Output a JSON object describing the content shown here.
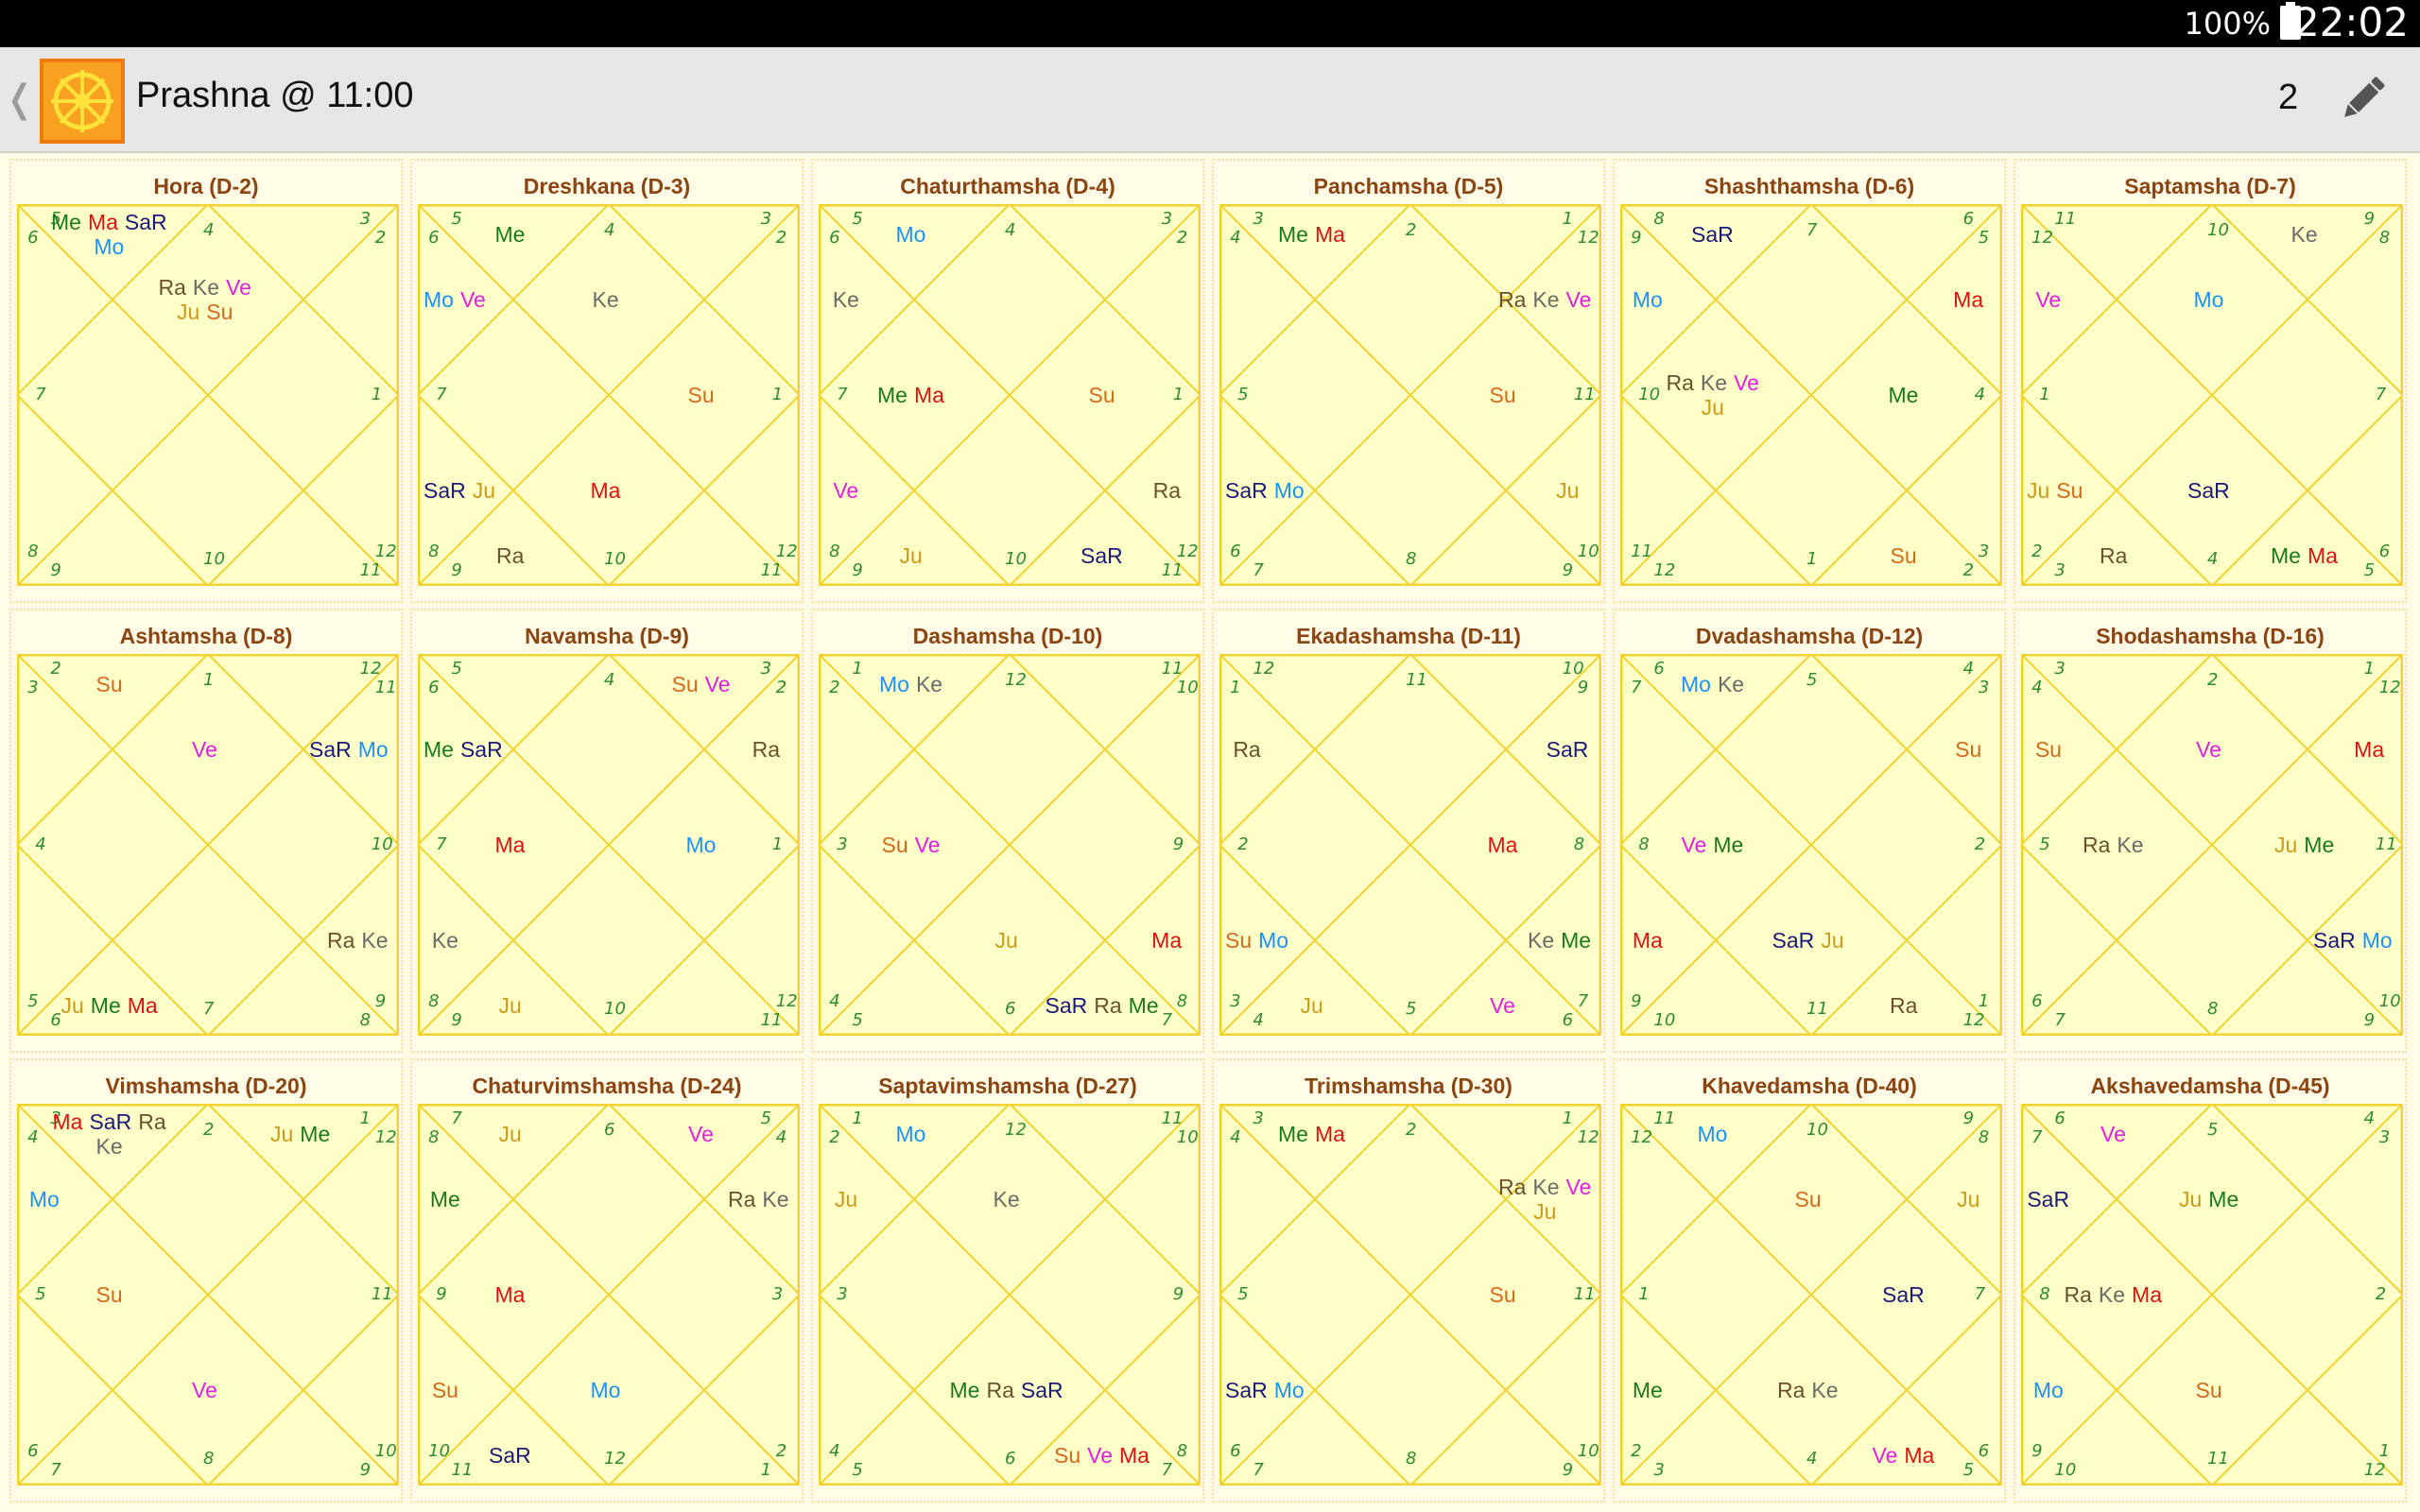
{
  "status_bar": {
    "battery": "100%",
    "time": "22:02"
  },
  "app_bar": {
    "title": "Prashna @ 11:00",
    "count": "2",
    "back_icon": "chevron-left-icon",
    "edit_icon": "pencil-icon",
    "logo_icon": "wheel-logo-icon"
  },
  "colors": {
    "background": "#fffbe6",
    "chart_fill": "#ffffc8",
    "chart_line": "#f0d232",
    "title": "#8b4513",
    "house_number": "#2e8b2e",
    "planets": {
      "Su": "#d2691e",
      "Mo": "#1e90ff",
      "Ma": "#dd1111",
      "Me": "#1a7a1a",
      "Ju": "#cc9a1a",
      "Ve": "#e020e0",
      "SaR": "#1a1a7a",
      "Ra": "#6b5030",
      "Ke": "#6a6a6a"
    }
  },
  "charts": [
    {
      "title": "Hora (D-2)",
      "numbers": [
        "5",
        "3",
        "4",
        "6",
        "2",
        "7",
        "1",
        "8",
        "10",
        "12",
        "9",
        "11"
      ],
      "houses": [
        [
          "Ra",
          "Ke",
          "Ve",
          "Ju",
          "Su"
        ],
        [
          "Me",
          "Ma",
          "SaR",
          "Mo"
        ],
        [],
        [],
        [],
        [],
        [],
        [],
        [],
        [],
        [],
        []
      ]
    },
    {
      "title": "Dreshkana (D-3)",
      "numbers": [
        "5",
        "3",
        "4",
        "6",
        "2",
        "7",
        "1",
        "8",
        "10",
        "12",
        "9",
        "11"
      ],
      "houses": [
        [
          "Ke"
        ],
        [
          "Me"
        ],
        [
          "Mo",
          "Ve"
        ],
        [],
        [
          "SaR",
          "Ju"
        ],
        [
          "Ra"
        ],
        [
          "Ma"
        ],
        [],
        [],
        [
          "Su"
        ],
        [],
        []
      ]
    },
    {
      "title": "Chaturthamsha (D-4)",
      "numbers": [
        "5",
        "3",
        "4",
        "6",
        "2",
        "7",
        "1",
        "8",
        "10",
        "12",
        "9",
        "11"
      ],
      "houses": [
        [],
        [
          "Mo"
        ],
        [
          "Ke"
        ],
        [
          "Me",
          "Ma"
        ],
        [
          "Ve"
        ],
        [
          "Ju"
        ],
        [],
        [
          "SaR"
        ],
        [
          "Ra"
        ],
        [
          "Su"
        ],
        [],
        []
      ]
    },
    {
      "title": "Panchamsha (D-5)",
      "numbers": [
        "3",
        "1",
        "2",
        "4",
        "12",
        "5",
        "11",
        "6",
        "8",
        "10",
        "7",
        "9"
      ],
      "houses": [
        [],
        [
          "Me",
          "Ma"
        ],
        [],
        [],
        [
          "SaR",
          "Mo"
        ],
        [],
        [],
        [],
        [
          "Ju"
        ],
        [
          "Su"
        ],
        [
          "Ra",
          "Ke",
          "Ve"
        ],
        []
      ]
    },
    {
      "title": "Shashthamsha (D-6)",
      "numbers": [
        "8",
        "6",
        "7",
        "9",
        "5",
        "10",
        "4",
        "11",
        "1",
        "3",
        "12",
        "2"
      ],
      "houses": [
        [],
        [
          "SaR"
        ],
        [
          "Mo"
        ],
        [
          "Ra",
          "Ke",
          "Ve",
          "Ju"
        ],
        [],
        [],
        [],
        [
          "Su"
        ],
        [],
        [
          "Me"
        ],
        [
          "Ma"
        ],
        []
      ]
    },
    {
      "title": "Saptamsha (D-7)",
      "numbers": [
        "11",
        "9",
        "10",
        "12",
        "8",
        "1",
        "7",
        "2",
        "4",
        "6",
        "3",
        "5"
      ],
      "houses": [
        [
          "Mo"
        ],
        [],
        [
          "Ve"
        ],
        [],
        [
          "Ju",
          "Su"
        ],
        [
          "Ra"
        ],
        [
          "SaR"
        ],
        [
          "Me",
          "Ma"
        ],
        [],
        [],
        [],
        [
          "Ke"
        ]
      ]
    },
    {
      "title": "Ashtamsha (D-8)",
      "numbers": [
        "2",
        "12",
        "1",
        "3",
        "11",
        "4",
        "10",
        "5",
        "7",
        "9",
        "6",
        "8"
      ],
      "houses": [
        [
          "Ve"
        ],
        [
          "Su"
        ],
        [],
        [],
        [],
        [
          "Ju",
          "Me",
          "Ma"
        ],
        [],
        [],
        [
          "Ra",
          "Ke"
        ],
        [],
        [
          "SaR",
          "Mo"
        ],
        []
      ]
    },
    {
      "title": "Navamsha (D-9)",
      "numbers": [
        "5",
        "3",
        "4",
        "6",
        "2",
        "7",
        "1",
        "8",
        "10",
        "12",
        "9",
        "11"
      ],
      "houses": [
        [],
        [],
        [
          "Me",
          "SaR"
        ],
        [
          "Ma"
        ],
        [
          "Ke"
        ],
        [
          "Ju"
        ],
        [],
        [],
        [],
        [
          "Mo"
        ],
        [
          "Ra"
        ],
        [
          "Su",
          "Ve"
        ]
      ]
    },
    {
      "title": "Dashamsha (D-10)",
      "numbers": [
        "1",
        "11",
        "12",
        "2",
        "10",
        "3",
        "9",
        "4",
        "6",
        "8",
        "5",
        "7"
      ],
      "houses": [
        [],
        [
          "Mo",
          "Ke"
        ],
        [],
        [
          "Su",
          "Ve"
        ],
        [],
        [],
        [
          "Ju"
        ],
        [
          "SaR",
          "Ra",
          "Me"
        ],
        [
          "Ma"
        ],
        [],
        [],
        []
      ]
    },
    {
      "title": "Ekadashamsha (D-11)",
      "numbers": [
        "12",
        "10",
        "11",
        "1",
        "9",
        "2",
        "8",
        "3",
        "5",
        "7",
        "4",
        "6"
      ],
      "houses": [
        [],
        [],
        [
          "Ra"
        ],
        [],
        [
          "Su",
          "Mo"
        ],
        [
          "Ju"
        ],
        [],
        [
          "Ve"
        ],
        [
          "Ke",
          "Me"
        ],
        [
          "Ma"
        ],
        [
          "SaR"
        ],
        []
      ]
    },
    {
      "title": "Dvadashamsha (D-12)",
      "numbers": [
        "6",
        "4",
        "5",
        "7",
        "3",
        "8",
        "2",
        "9",
        "11",
        "1",
        "10",
        "12"
      ],
      "houses": [
        [],
        [
          "Mo",
          "Ke"
        ],
        [],
        [
          "Ve",
          "Me"
        ],
        [
          "Ma"
        ],
        [],
        [
          "SaR",
          "Ju"
        ],
        [
          "Ra"
        ],
        [],
        [],
        [
          "Su"
        ],
        []
      ]
    },
    {
      "title": "Shodashamsha (D-16)",
      "numbers": [
        "3",
        "1",
        "2",
        "4",
        "12",
        "5",
        "11",
        "6",
        "8",
        "10",
        "7",
        "9"
      ],
      "houses": [
        [
          "Ve"
        ],
        [],
        [
          "Su"
        ],
        [
          "Ra",
          "Ke"
        ],
        [],
        [],
        [],
        [],
        [
          "SaR",
          "Mo"
        ],
        [
          "Ju",
          "Me"
        ],
        [
          "Ma"
        ],
        []
      ]
    },
    {
      "title": "Vimshamsha (D-20)",
      "numbers": [
        "3",
        "1",
        "2",
        "4",
        "12",
        "5",
        "11",
        "6",
        "8",
        "10",
        "7",
        "9"
      ],
      "houses": [
        [],
        [
          "Ma",
          "SaR",
          "Ra",
          "Ke"
        ],
        [
          "Mo"
        ],
        [
          "Su"
        ],
        [],
        [],
        [
          "Ve"
        ],
        [],
        [],
        [],
        [],
        [
          "Ju",
          "Me"
        ]
      ]
    },
    {
      "title": "Chaturvimshamsha (D-24)",
      "numbers": [
        "7",
        "5",
        "6",
        "8",
        "4",
        "9",
        "3",
        "10",
        "12",
        "2",
        "11",
        "1"
      ],
      "houses": [
        [],
        [
          "Ju"
        ],
        [
          "Me"
        ],
        [
          "Ma"
        ],
        [
          "Su"
        ],
        [
          "SaR"
        ],
        [
          "Mo"
        ],
        [],
        [],
        [],
        [
          "Ra",
          "Ke"
        ],
        [
          "Ve"
        ]
      ]
    },
    {
      "title": "Saptavimshamsha (D-27)",
      "numbers": [
        "1",
        "11",
        "12",
        "2",
        "10",
        "3",
        "9",
        "4",
        "6",
        "8",
        "5",
        "7"
      ],
      "houses": [
        [
          "Ke"
        ],
        [
          "Mo"
        ],
        [
          "Ju"
        ],
        [],
        [],
        [],
        [
          "Me",
          "Ra",
          "SaR"
        ],
        [
          "Su",
          "Ve",
          "Ma"
        ],
        [],
        [],
        [],
        []
      ]
    },
    {
      "title": "Trimshamsha (D-30)",
      "numbers": [
        "3",
        "1",
        "2",
        "4",
        "12",
        "5",
        "11",
        "6",
        "8",
        "10",
        "7",
        "9"
      ],
      "houses": [
        [],
        [
          "Me",
          "Ma"
        ],
        [],
        [],
        [
          "SaR",
          "Mo"
        ],
        [],
        [],
        [],
        [],
        [
          "Su"
        ],
        [
          "Ra",
          "Ke",
          "Ve",
          "Ju"
        ],
        []
      ]
    },
    {
      "title": "Khavedamsha (D-40)",
      "numbers": [
        "11",
        "9",
        "10",
        "12",
        "8",
        "1",
        "7",
        "2",
        "4",
        "6",
        "3",
        "5"
      ],
      "houses": [
        [
          "Su"
        ],
        [
          "Mo"
        ],
        [],
        [],
        [
          "Me"
        ],
        [],
        [
          "Ra",
          "Ke"
        ],
        [
          "Ve",
          "Ma"
        ],
        [],
        [
          "SaR"
        ],
        [
          "Ju"
        ],
        []
      ]
    },
    {
      "title": "Akshavedamsha (D-45)",
      "numbers": [
        "6",
        "4",
        "5",
        "7",
        "3",
        "8",
        "2",
        "9",
        "11",
        "1",
        "10",
        "12"
      ],
      "houses": [
        [
          "Ju",
          "Me"
        ],
        [
          "Ve"
        ],
        [
          "SaR"
        ],
        [
          "Ra",
          "Ke",
          "Ma"
        ],
        [
          "Mo"
        ],
        [],
        [
          "Su"
        ],
        [],
        [],
        [],
        [],
        []
      ]
    }
  ]
}
